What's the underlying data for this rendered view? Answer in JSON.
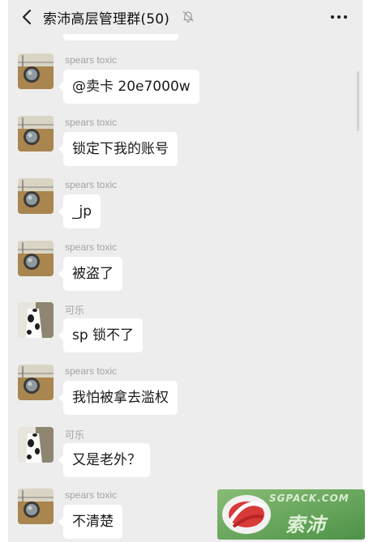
{
  "header": {
    "title": "索沛高层管理群(50)",
    "back_icon": "chevron-left-icon",
    "mute_icon": "bell-muted-icon",
    "more_icon": "more-dots-icon"
  },
  "messages": [
    {
      "sender": "spears toxic",
      "text": "@卖卡 20e7000w",
      "avatar": "landscape-avatar"
    },
    {
      "sender": "spears toxic",
      "text": "锁定下我的账号",
      "avatar": "landscape-avatar"
    },
    {
      "sender": "spears toxic",
      "text": "_jp",
      "avatar": "landscape-avatar"
    },
    {
      "sender": "spears toxic",
      "text": "被盗了",
      "avatar": "landscape-avatar"
    },
    {
      "sender": "可乐",
      "text": "sp 锁不了",
      "avatar": "cow-avatar"
    },
    {
      "sender": "spears toxic",
      "text": "我怕被拿去滥权",
      "avatar": "landscape-avatar"
    },
    {
      "sender": "可乐",
      "text": "又是老外？",
      "avatar": "cow-avatar"
    },
    {
      "sender": "spears toxic",
      "text": "不清楚",
      "avatar": "landscape-avatar"
    }
  ],
  "watermark": {
    "url": "SGPACK.COM",
    "name": "索沛"
  },
  "colors": {
    "background": "#ededed",
    "bubble": "#ffffff",
    "sender_text": "#a3a3a3",
    "title_text": "#111111"
  }
}
